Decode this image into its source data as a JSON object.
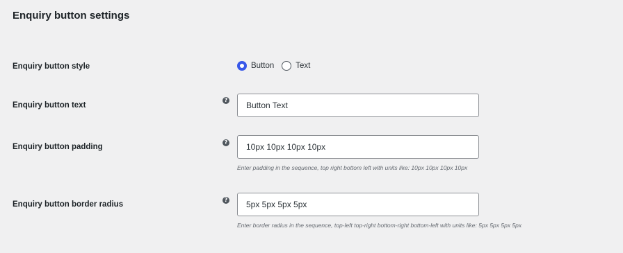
{
  "section": {
    "title": "Enquiry button settings"
  },
  "rows": {
    "style": {
      "label": "Enquiry button style",
      "options": [
        {
          "label": "Button",
          "checked": true
        },
        {
          "label": "Text",
          "checked": false
        }
      ]
    },
    "text": {
      "label": "Enquiry button text",
      "help_icon": "?",
      "value": "Button Text"
    },
    "padding": {
      "label": "Enquiry button padding",
      "help_icon": "?",
      "value": "10px 10px 10px 10px",
      "description": "Enter padding in the sequence, top right bottom left with units like: 10px 10px 10px 10px"
    },
    "radius": {
      "label": "Enquiry button border radius",
      "help_icon": "?",
      "value": "5px 5px 5px 5px",
      "description": "Enter border radius in the sequence, top-left top-right bottom-right bottom-left with units like: 5px 5px 5px 5px"
    }
  },
  "colors": {
    "accent": "#3858e9",
    "background": "#f0f0f1"
  }
}
